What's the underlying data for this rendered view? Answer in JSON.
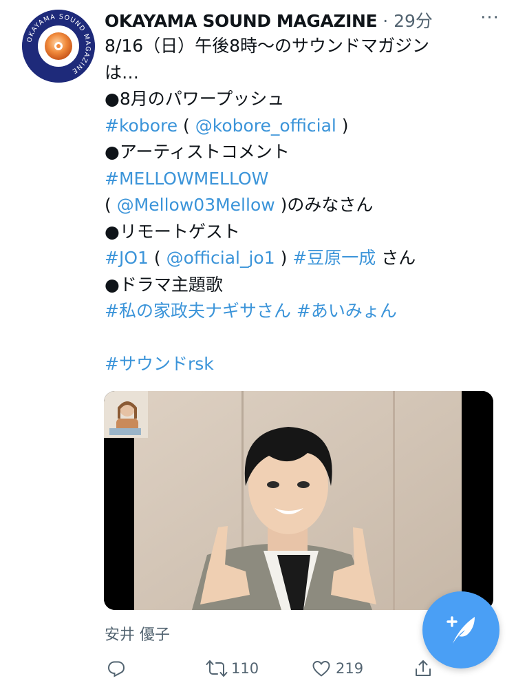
{
  "tweet": {
    "author": {
      "name": "OKAYAMA SOUND MAGAZINE",
      "avatar_ring_text": "OKAYAMA SOUND MAGAZINE",
      "avatar_colors": {
        "ring": "#1e2a7a",
        "inner": "#ffffff",
        "center": "#f08a3c"
      }
    },
    "separator": "·",
    "time": "29分",
    "more_icon": "more-icon",
    "text_lines": [
      {
        "parts": [
          {
            "text": "8/16（日）午後8時〜のサウンドマガジン",
            "type": "text"
          }
        ]
      },
      {
        "parts": [
          {
            "text": "は…",
            "type": "text"
          }
        ]
      },
      {
        "parts": [
          {
            "text": "●8月のパワープッシュ",
            "type": "text"
          }
        ]
      },
      {
        "parts": [
          {
            "text": "#kobore",
            "type": "hashtag"
          },
          {
            "text": " ( ",
            "type": "text"
          },
          {
            "text": "@kobore_official",
            "type": "mention"
          },
          {
            "text": " )",
            "type": "text"
          }
        ]
      },
      {
        "parts": [
          {
            "text": "●アーティストコメント",
            "type": "text"
          }
        ]
      },
      {
        "parts": [
          {
            "text": "#MELLOWMELLOW",
            "type": "hashtag"
          }
        ]
      },
      {
        "parts": [
          {
            "text": "( ",
            "type": "text"
          },
          {
            "text": "@Mellow03Mellow",
            "type": "mention"
          },
          {
            "text": " )のみなさん",
            "type": "text"
          }
        ]
      },
      {
        "parts": [
          {
            "text": "●リモートゲスト",
            "type": "text"
          }
        ]
      },
      {
        "parts": [
          {
            "text": "#JO1",
            "type": "hashtag"
          },
          {
            "text": " ( ",
            "type": "text"
          },
          {
            "text": "@official_jo1",
            "type": "mention"
          },
          {
            "text": " ) ",
            "type": "text"
          },
          {
            "text": "#豆原一成",
            "type": "hashtag"
          },
          {
            "text": " さん",
            "type": "text"
          }
        ]
      },
      {
        "parts": [
          {
            "text": "●ドラマ主題歌",
            "type": "text"
          }
        ]
      },
      {
        "parts": [
          {
            "text": "#私の家政夫ナギサさん",
            "type": "hashtag"
          },
          {
            "text": " ",
            "type": "text"
          },
          {
            "text": "#あいみょん",
            "type": "hashtag"
          }
        ]
      },
      {
        "parts": []
      },
      {
        "parts": [
          {
            "text": "#サウンドrsk",
            "type": "hashtag"
          }
        ]
      }
    ],
    "media": {
      "kind": "video-call-photo"
    },
    "caption": "安井 優子",
    "actions": {
      "reply_icon": "reply-icon",
      "retweet_icon": "retweet-icon",
      "retweet_count": "110",
      "like_icon": "heart-icon",
      "like_count": "219",
      "share_icon": "share-icon"
    }
  },
  "fab": {
    "icon": "compose-tweet-icon"
  },
  "colors": {
    "link": "#3b94d9",
    "muted": "#536471",
    "fab": "#4a9ff5",
    "text": "#0f1419"
  }
}
